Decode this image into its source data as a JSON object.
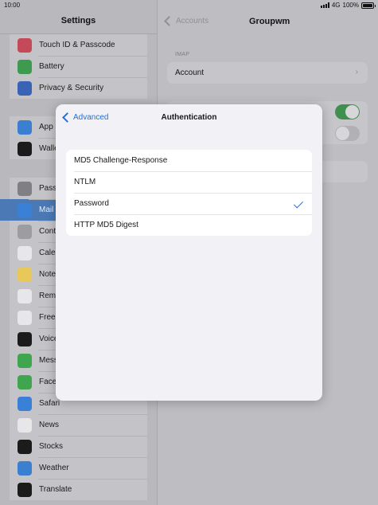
{
  "status": {
    "time": "10:00",
    "network": "4G",
    "battery": "100%"
  },
  "sidebar": {
    "title": "Settings",
    "group1": [
      {
        "label": "Touch ID & Passcode",
        "icon": "fingerprint-icon",
        "color": "#c44a5a"
      },
      {
        "label": "Battery",
        "icon": "battery-icon",
        "color": "#3e9a4f"
      },
      {
        "label": "Privacy & Security",
        "icon": "hand-icon",
        "color": "#3a63b6"
      }
    ],
    "group2": [
      {
        "label": "App",
        "icon": "app-store-icon",
        "color": "#3a7fd0"
      },
      {
        "label": "Walle",
        "icon": "wallet-icon",
        "color": "#1b1b1b"
      }
    ],
    "group3": [
      {
        "label": "Pass",
        "icon": "key-icon",
        "color": "#7f7f84"
      },
      {
        "label": "Mail",
        "icon": "mail-icon",
        "color": "#3a80d6",
        "selected": true
      },
      {
        "label": "Conta",
        "icon": "contacts-icon",
        "color": "#9d9d9f"
      },
      {
        "label": "Cale",
        "icon": "calendar-icon",
        "color": "#e7e7ea"
      },
      {
        "label": "Note",
        "icon": "notes-icon",
        "color": "#e7c858"
      },
      {
        "label": "Rem",
        "icon": "reminders-icon",
        "color": "#e7e7ea"
      },
      {
        "label": "Free",
        "icon": "freeform-icon",
        "color": "#e7e7ea"
      },
      {
        "label": "Voice",
        "icon": "voice-memos-icon",
        "color": "#1b1b1b"
      },
      {
        "label": "Mess",
        "icon": "messages-icon",
        "color": "#3fa54f"
      },
      {
        "label": "Face",
        "icon": "facetime-icon",
        "color": "#3fa54f"
      },
      {
        "label": "Safari",
        "icon": "safari-icon",
        "color": "#3a80d6"
      },
      {
        "label": "News",
        "icon": "news-icon",
        "color": "#e7e7ea"
      },
      {
        "label": "Stocks",
        "icon": "stocks-icon",
        "color": "#1b1b1b"
      },
      {
        "label": "Weather",
        "icon": "weather-icon",
        "color": "#3a7fd0"
      },
      {
        "label": "Translate",
        "icon": "translate-icon",
        "color": "#1b1b1b"
      }
    ]
  },
  "detail": {
    "back_label": "Accounts",
    "title": "Groupwm",
    "section_header": "IMAP",
    "account_label": "Account"
  },
  "sheet": {
    "back_label": "Advanced",
    "title": "Authentication",
    "options": [
      {
        "label": "MD5 Challenge-Response",
        "checked": false
      },
      {
        "label": "NTLM",
        "checked": false
      },
      {
        "label": "Password",
        "checked": true
      },
      {
        "label": "HTTP MD5 Digest",
        "checked": false
      }
    ],
    "accent": "#1a73e8"
  }
}
